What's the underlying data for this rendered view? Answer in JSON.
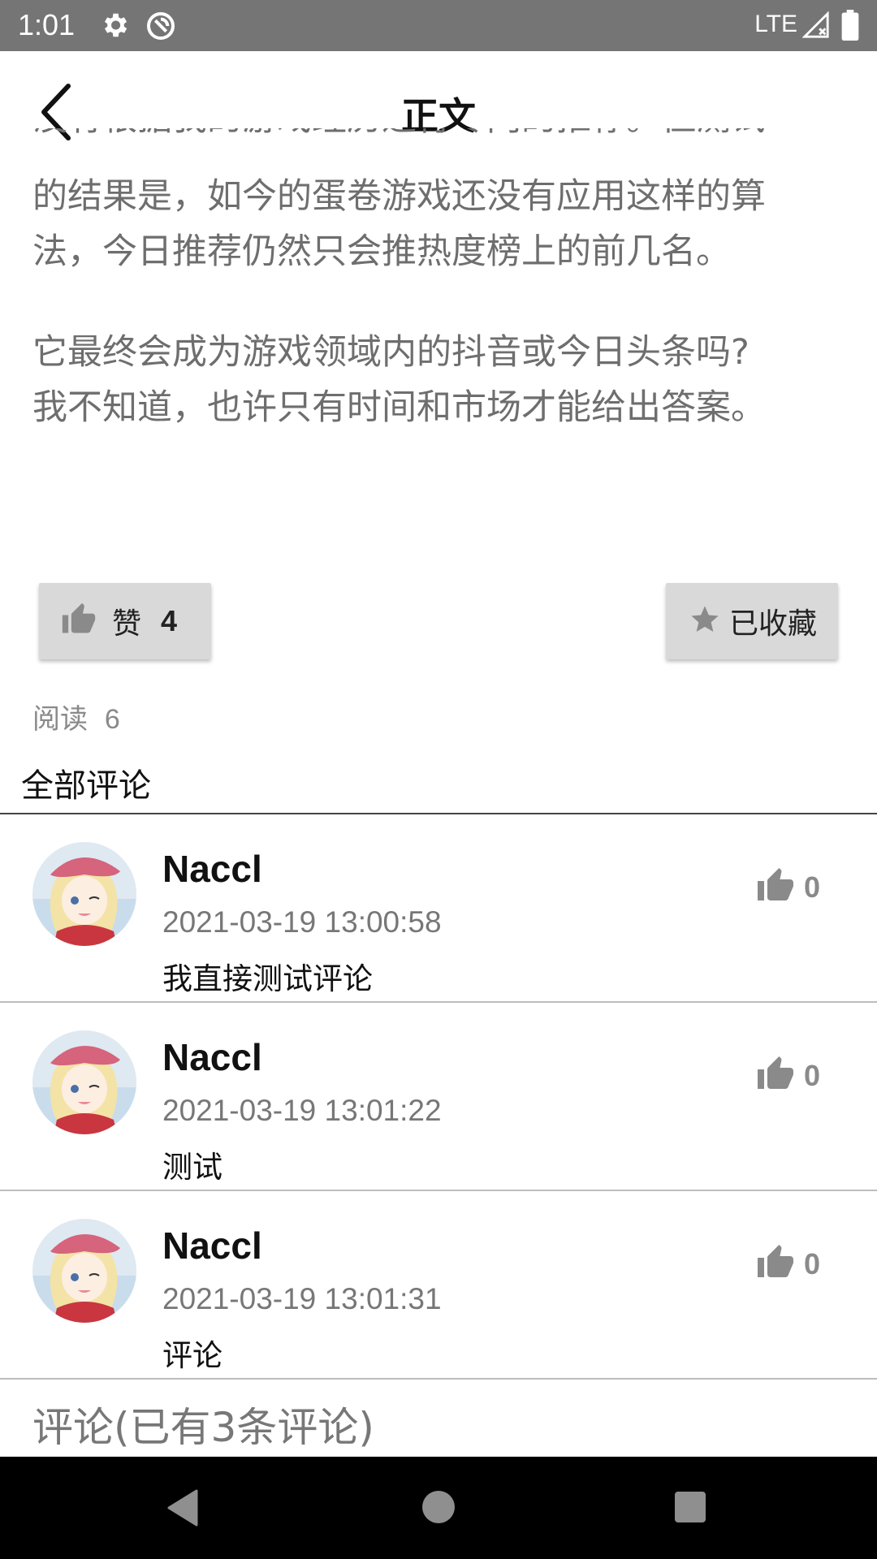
{
  "status_bar": {
    "time": "1:01",
    "network": "LTE",
    "icons": [
      "settings-icon",
      "no-disturb-icon",
      "signal-icon",
      "battery-icon"
    ]
  },
  "app_bar": {
    "title": "正文",
    "back_icon": "chevron-left-icon"
  },
  "article": {
    "partial_line": "没有根据我的游戏经历进行专门的推荐。但测试",
    "paragraph1_lines": [
      "的结果是，如今的蛋卷游戏还没有应用这样的算",
      "法，今日推荐仍然只会推热度榜上的前几名。"
    ],
    "paragraph2_lines": [
      "它最终会成为游戏领域内的抖音或今日头条吗?",
      "我不知道，也许只有时间和市场才能给出答案。"
    ]
  },
  "actions": {
    "like_label": "赞",
    "like_count": "4",
    "favorite_label": "已收藏"
  },
  "reads": {
    "label": "阅读",
    "count": "6"
  },
  "comments_header": "全部评论",
  "comments": [
    {
      "name": "Naccl",
      "time": "2021-03-19 13:00:58",
      "text": "我直接测试评论",
      "likes": "0"
    },
    {
      "name": "Naccl",
      "time": "2021-03-19 13:01:22",
      "text": "测试",
      "likes": "0"
    },
    {
      "name": "Naccl",
      "time": "2021-03-19 13:01:31",
      "text": "评论",
      "likes": "0"
    }
  ],
  "comment_input_placeholder": "评论(已有3条评论)",
  "colors": {
    "status_bar": "#757575",
    "button_bg": "#d9d9d9",
    "article_text": "#6e6e6e",
    "nav_bar": "#000000"
  }
}
